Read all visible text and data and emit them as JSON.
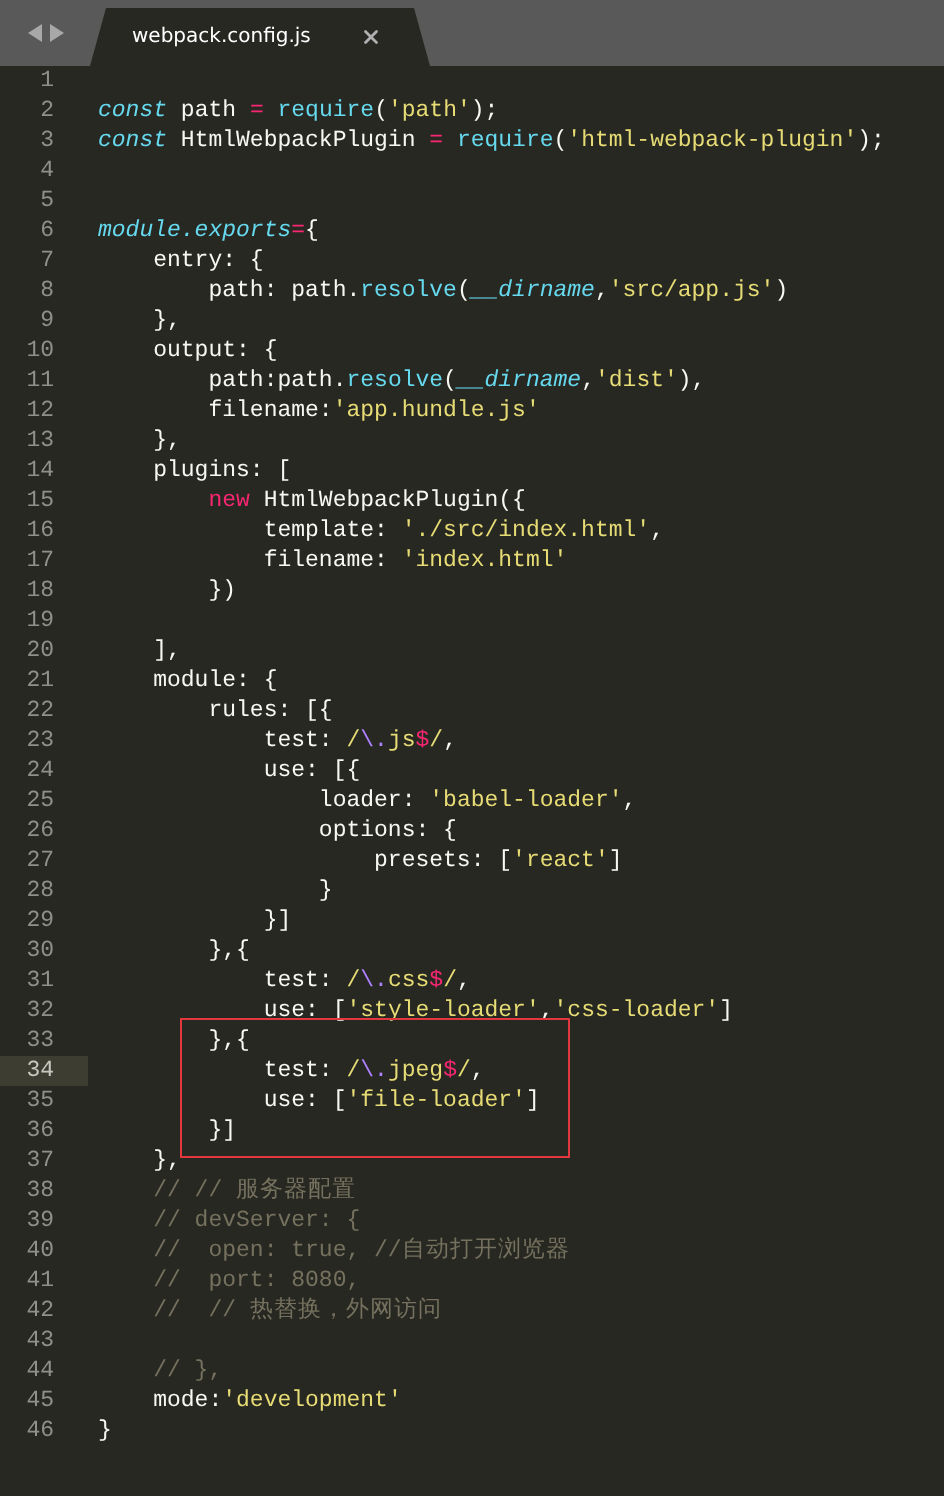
{
  "tab": {
    "title": "webpack.config.js",
    "selected": true
  },
  "lines": [
    {
      "number": "1",
      "current": false,
      "annotated": false
    },
    {
      "number": "2",
      "current": false,
      "annotated": false,
      "tokens": [
        {
          "kind": "storage",
          "text": "const"
        },
        {
          "kind": "plain",
          "text": " path "
        },
        {
          "kind": "keyword",
          "text": "= "
        },
        {
          "kind": "support",
          "text": "require"
        },
        {
          "kind": "plain",
          "text": "("
        },
        {
          "kind": "string",
          "text": "'path'"
        },
        {
          "kind": "plain",
          "text": ");"
        }
      ]
    },
    {
      "number": "3",
      "current": false,
      "annotated": false,
      "tokens": [
        {
          "kind": "storage",
          "text": "const"
        },
        {
          "kind": "plain",
          "text": " HtmlWebpackPlugin "
        },
        {
          "kind": "keyword",
          "text": "= "
        },
        {
          "kind": "support",
          "text": "require"
        },
        {
          "kind": "plain",
          "text": "("
        },
        {
          "kind": "string",
          "text": "'html-webpack-plugin'"
        },
        {
          "kind": "plain",
          "text": ");"
        }
      ]
    },
    {
      "number": "4",
      "current": false,
      "annotated": false
    },
    {
      "number": "5",
      "current": false,
      "annotated": false
    },
    {
      "number": "6",
      "current": false,
      "annotated": false,
      "tokens": [
        {
          "kind": "storage",
          "text": "module.exports"
        },
        {
          "kind": "keyword",
          "text": "="
        },
        {
          "kind": "plain",
          "text": "{"
        }
      ]
    },
    {
      "number": "7",
      "current": false,
      "annotated": false,
      "tokens": [
        {
          "kind": "plain",
          "text": "    entry: {"
        }
      ]
    },
    {
      "number": "8",
      "current": false,
      "annotated": false,
      "tokens": [
        {
          "kind": "plain",
          "text": "        path: path."
        },
        {
          "kind": "support",
          "text": "resolve"
        },
        {
          "kind": "plain",
          "text": "("
        },
        {
          "kind": "storage",
          "text": "__dirname"
        },
        {
          "kind": "plain",
          "text": ","
        },
        {
          "kind": "string",
          "text": "'src/app.js'"
        },
        {
          "kind": "plain",
          "text": ")"
        }
      ]
    },
    {
      "number": "9",
      "current": false,
      "annotated": false,
      "tokens": [
        {
          "kind": "plain",
          "text": "    },"
        }
      ]
    },
    {
      "number": "10",
      "current": false,
      "annotated": false,
      "tokens": [
        {
          "kind": "plain",
          "text": "    output: {"
        }
      ]
    },
    {
      "number": "11",
      "current": false,
      "annotated": false,
      "tokens": [
        {
          "kind": "plain",
          "text": "        path:path."
        },
        {
          "kind": "support",
          "text": "resolve"
        },
        {
          "kind": "plain",
          "text": "("
        },
        {
          "kind": "storage",
          "text": "__dirname"
        },
        {
          "kind": "plain",
          "text": ","
        },
        {
          "kind": "string",
          "text": "'dist'"
        },
        {
          "kind": "plain",
          "text": "),"
        }
      ]
    },
    {
      "number": "12",
      "current": false,
      "annotated": false,
      "tokens": [
        {
          "kind": "plain",
          "text": "        filename:"
        },
        {
          "kind": "string",
          "text": "'app.hundle.js'"
        }
      ]
    },
    {
      "number": "13",
      "current": false,
      "annotated": false,
      "tokens": [
        {
          "kind": "plain",
          "text": "    },"
        }
      ]
    },
    {
      "number": "14",
      "current": false,
      "annotated": false,
      "tokens": [
        {
          "kind": "plain",
          "text": "    plugins: ["
        }
      ]
    },
    {
      "number": "15",
      "current": false,
      "annotated": false,
      "tokens": [
        {
          "kind": "keyword",
          "text": "        new"
        },
        {
          "kind": "plain",
          "text": " HtmlWebpackPlugin({"
        }
      ]
    },
    {
      "number": "16",
      "current": false,
      "annotated": false,
      "tokens": [
        {
          "kind": "plain",
          "text": "            template: "
        },
        {
          "kind": "string",
          "text": "'./src/index.html'"
        },
        {
          "kind": "plain",
          "text": ","
        }
      ]
    },
    {
      "number": "17",
      "current": false,
      "annotated": false,
      "tokens": [
        {
          "kind": "plain",
          "text": "            filename: "
        },
        {
          "kind": "string",
          "text": "'index.html'"
        }
      ]
    },
    {
      "number": "18",
      "current": false,
      "annotated": false,
      "tokens": [
        {
          "kind": "plain",
          "text": "        })"
        }
      ]
    },
    {
      "number": "19",
      "current": false,
      "annotated": false
    },
    {
      "number": "20",
      "current": false,
      "annotated": false,
      "tokens": [
        {
          "kind": "plain",
          "text": "    ],"
        }
      ]
    },
    {
      "number": "21",
      "current": false,
      "annotated": false,
      "tokens": [
        {
          "kind": "plain",
          "text": "    module: {"
        }
      ]
    },
    {
      "number": "22",
      "current": false,
      "annotated": false,
      "tokens": [
        {
          "kind": "plain",
          "text": "        rules: [{"
        }
      ]
    },
    {
      "number": "23",
      "current": false,
      "annotated": false,
      "tokens": [
        {
          "kind": "plain",
          "text": "            test: "
        },
        {
          "kind": "string",
          "text": "/"
        },
        {
          "kind": "escape",
          "text": "\\."
        },
        {
          "kind": "string",
          "text": "js"
        },
        {
          "kind": "keyword",
          "text": "$"
        },
        {
          "kind": "string",
          "text": "/"
        },
        {
          "kind": "plain",
          "text": ","
        }
      ]
    },
    {
      "number": "24",
      "current": false,
      "annotated": false,
      "tokens": [
        {
          "kind": "plain",
          "text": "            use: [{"
        }
      ]
    },
    {
      "number": "25",
      "current": false,
      "annotated": false,
      "tokens": [
        {
          "kind": "plain",
          "text": "                loader: "
        },
        {
          "kind": "string",
          "text": "'babel-loader'"
        },
        {
          "kind": "plain",
          "text": ","
        }
      ]
    },
    {
      "number": "26",
      "current": false,
      "annotated": false,
      "tokens": [
        {
          "kind": "plain",
          "text": "                options: {"
        }
      ]
    },
    {
      "number": "27",
      "current": false,
      "annotated": false,
      "tokens": [
        {
          "kind": "plain",
          "text": "                    presets: ["
        },
        {
          "kind": "string",
          "text": "'react'"
        },
        {
          "kind": "plain",
          "text": "]"
        }
      ]
    },
    {
      "number": "28",
      "current": false,
      "annotated": false,
      "tokens": [
        {
          "kind": "plain",
          "text": "                }"
        }
      ]
    },
    {
      "number": "29",
      "current": false,
      "annotated": false,
      "tokens": [
        {
          "kind": "plain",
          "text": "            }]"
        }
      ]
    },
    {
      "number": "30",
      "current": false,
      "annotated": false,
      "tokens": [
        {
          "kind": "plain",
          "text": "        },{"
        }
      ]
    },
    {
      "number": "31",
      "current": false,
      "annotated": false,
      "tokens": [
        {
          "kind": "plain",
          "text": "            test: "
        },
        {
          "kind": "string",
          "text": "/"
        },
        {
          "kind": "escape",
          "text": "\\."
        },
        {
          "kind": "string",
          "text": "css"
        },
        {
          "kind": "keyword",
          "text": "$"
        },
        {
          "kind": "string",
          "text": "/"
        },
        {
          "kind": "plain",
          "text": ","
        }
      ]
    },
    {
      "number": "32",
      "current": false,
      "annotated": false,
      "tokens": [
        {
          "kind": "plain",
          "text": "            use: ["
        },
        {
          "kind": "string",
          "text": "'style-loader'"
        },
        {
          "kind": "plain",
          "text": ","
        },
        {
          "kind": "string",
          "text": "'css-loader'"
        },
        {
          "kind": "plain",
          "text": "]"
        }
      ]
    },
    {
      "number": "33",
      "current": false,
      "annotated": true,
      "tokens": [
        {
          "kind": "plain",
          "text": "        },{"
        }
      ]
    },
    {
      "number": "34",
      "current": true,
      "annotated": true,
      "tokens": [
        {
          "kind": "plain",
          "text": "            test: "
        },
        {
          "kind": "string",
          "text": "/"
        },
        {
          "kind": "escape",
          "text": "\\."
        },
        {
          "kind": "string",
          "text": "jpeg"
        },
        {
          "kind": "keyword",
          "text": "$"
        },
        {
          "kind": "string",
          "text": "/"
        },
        {
          "kind": "plain",
          "text": ","
        }
      ]
    },
    {
      "number": "35",
      "current": false,
      "annotated": true,
      "tokens": [
        {
          "kind": "plain",
          "text": "            use: ["
        },
        {
          "kind": "string",
          "text": "'file-loader'"
        },
        {
          "kind": "plain",
          "text": "]"
        }
      ]
    },
    {
      "number": "36",
      "current": false,
      "annotated": true,
      "tokens": [
        {
          "kind": "plain",
          "text": "        }]"
        }
      ]
    },
    {
      "number": "37",
      "current": false,
      "annotated": false,
      "tokens": [
        {
          "kind": "plain",
          "text": "    },"
        }
      ]
    },
    {
      "number": "38",
      "current": false,
      "annotated": false,
      "tokens": [
        {
          "kind": "comment",
          "text": "    // // 服务器配置"
        }
      ]
    },
    {
      "number": "39",
      "current": false,
      "annotated": false,
      "tokens": [
        {
          "kind": "comment",
          "text": "    // devServer: {"
        }
      ]
    },
    {
      "number": "40",
      "current": false,
      "annotated": false,
      "tokens": [
        {
          "kind": "comment",
          "text": "    //  open: true, //自动打开浏览器"
        }
      ]
    },
    {
      "number": "41",
      "current": false,
      "annotated": false,
      "tokens": [
        {
          "kind": "comment",
          "text": "    //  port: 8080,"
        }
      ]
    },
    {
      "number": "42",
      "current": false,
      "annotated": false,
      "tokens": [
        {
          "kind": "comment",
          "text": "    //  // 热替换，外网访问"
        }
      ]
    },
    {
      "number": "43",
      "current": false,
      "annotated": false
    },
    {
      "number": "44",
      "current": false,
      "annotated": false,
      "tokens": [
        {
          "kind": "comment",
          "text": "    // },"
        }
      ]
    },
    {
      "number": "45",
      "current": false,
      "annotated": false,
      "tokens": [
        {
          "kind": "plain",
          "text": "    mode:"
        },
        {
          "kind": "string",
          "text": "'development'"
        }
      ]
    },
    {
      "number": "46",
      "current": false,
      "annotated": false,
      "tokens": [
        {
          "kind": "plain",
          "text": "}"
        }
      ]
    }
  ]
}
